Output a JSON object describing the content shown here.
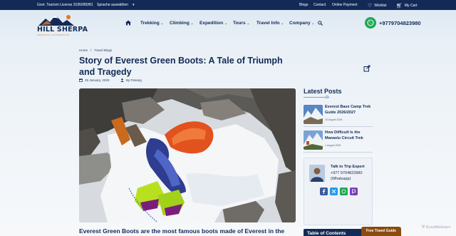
{
  "topbar": {
    "license": "Govt. Tourism License 3195/080/81",
    "language": "Sprache auswählen",
    "links": [
      "Blogs",
      "Contact",
      "Online Payment"
    ],
    "wishlist": "Wishlist",
    "cart": "My Cart"
  },
  "brand": {
    "name": "HILL SHERPA",
    "tagline": "TREKKING & EXPEDITION"
  },
  "nav": {
    "items": [
      "Trekking",
      "Climbing",
      "Expedition",
      "Tours",
      "Travel Info",
      "Company"
    ],
    "phone": "+9779704823980"
  },
  "breadcrumb": [
    "Home",
    "Travel Blogs"
  ],
  "article": {
    "title": "Story of Everest Green Boots: A Tale of Triumph and Tragedy",
    "date": "29 January, 2025",
    "author": "By Pasang",
    "lede": "Everest Green Boots are the most famous boots made of Everest in the"
  },
  "sidebar": {
    "latest_heading": "Latest Posts",
    "posts": [
      {
        "title": "Everest Base Camp Trek Guide 2026/2027",
        "date": "10 August 2026"
      },
      {
        "title": "How Difficult Is the Manaslu Circuit Trek",
        "date": "1 August 2026"
      }
    ],
    "expert": {
      "heading": "Talk to Trip Expert",
      "phone": "+977 9704823980",
      "whatsapp": "(Whatsapp)"
    },
    "toc_heading": "Table of Contents"
  },
  "floating": {
    "guide_button": "Free Travel Guide",
    "badge": "ScanMalware"
  },
  "colors": {
    "navy": "#132a57",
    "whatsapp": "#1da851",
    "guide": "#8a4b0f"
  }
}
